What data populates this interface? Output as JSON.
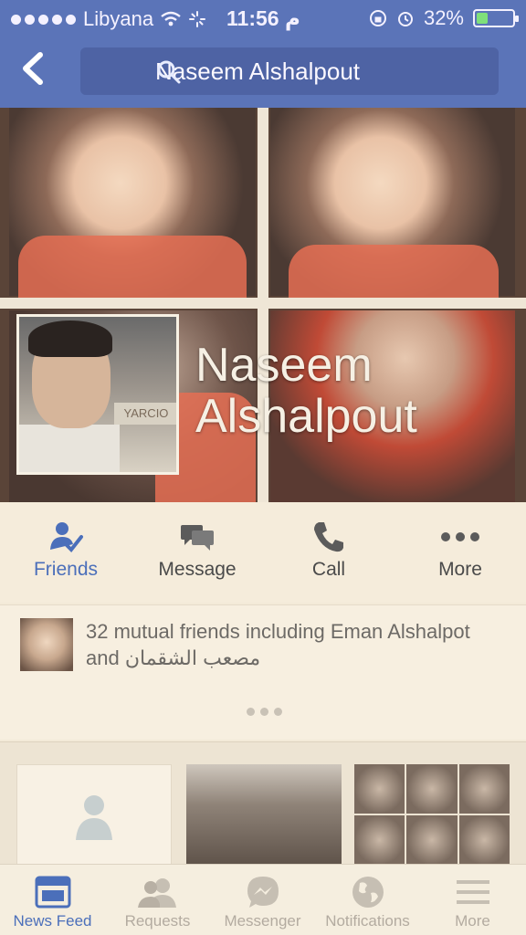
{
  "status_bar": {
    "carrier": "Libyana",
    "time": "11:56 م",
    "battery_percent": "32%",
    "battery_level": 0.32
  },
  "nav": {
    "back_icon": "chevron-left-icon",
    "search_text": "Naseem Alshalpout"
  },
  "profile": {
    "name_line1": "Naseem",
    "name_line2": "Alshalpout",
    "avatar_sign": "YARCIO"
  },
  "actions": [
    {
      "label": "Friends",
      "icon": "friends-check-icon"
    },
    {
      "label": "Message",
      "icon": "message-icon"
    },
    {
      "label": "Call",
      "icon": "phone-icon"
    },
    {
      "label": "More",
      "icon": "more-dots-icon"
    }
  ],
  "mutual": {
    "text": "32 mutual friends including Eman Alshalpot and مصعب الشقمان"
  },
  "tabs": [
    {
      "label": "News Feed",
      "icon": "news-feed-icon",
      "active": true
    },
    {
      "label": "Requests",
      "icon": "requests-icon"
    },
    {
      "label": "Messenger",
      "icon": "messenger-icon"
    },
    {
      "label": "Notifications",
      "icon": "globe-icon"
    },
    {
      "label": "More",
      "icon": "menu-icon"
    }
  ],
  "colors": {
    "accent": "#4b6fba",
    "header": "#5b74b8",
    "background": "#f3ead8"
  }
}
